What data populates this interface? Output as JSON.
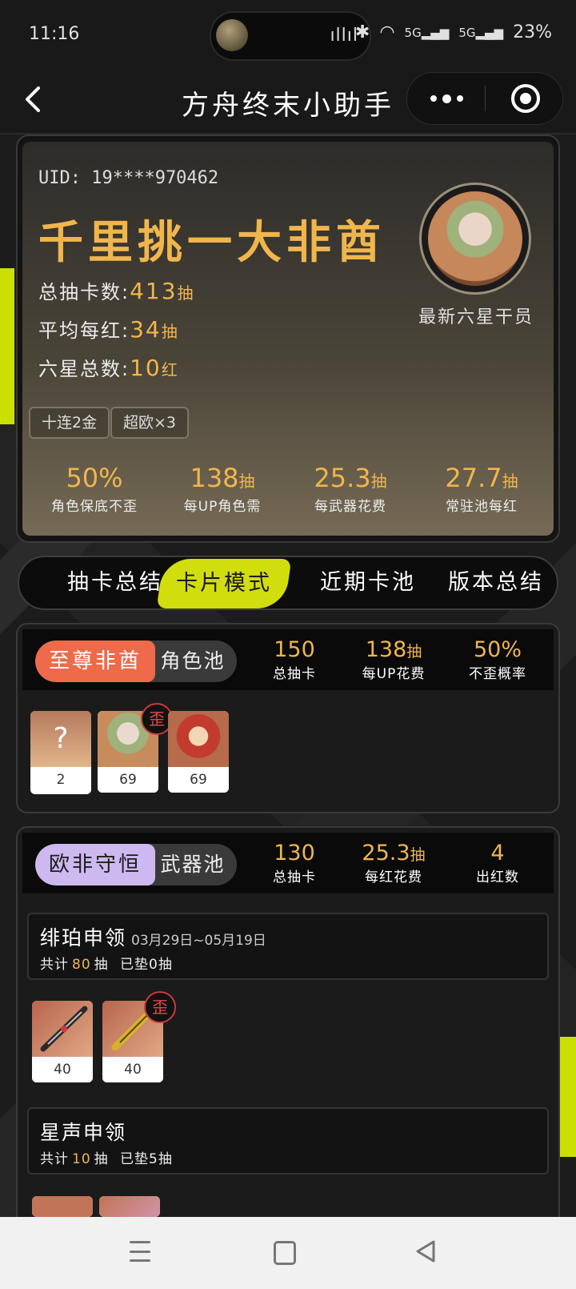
{
  "status_bar": {
    "time": "11:16",
    "battery": "23%",
    "signal1": "5G",
    "signal2": "5G"
  },
  "header": {
    "title": "方舟终末小助手"
  },
  "profile": {
    "uid": "UID: 19****970462",
    "nickname": "千里挑一大非酋",
    "stats": [
      {
        "label": "总抽卡数:",
        "value": "413",
        "unit": "抽"
      },
      {
        "label": "平均每红:",
        "value": "34",
        "unit": "抽"
      },
      {
        "label": "六星总数:",
        "value": "10",
        "unit": "红"
      }
    ],
    "avatar_caption": "最新六星干员",
    "tags": [
      "十连2金",
      "超欧×3"
    ],
    "summary": [
      {
        "value": "50%",
        "unit": "",
        "label": "角色保底不歪"
      },
      {
        "value": "138",
        "unit": "抽",
        "label": "每UP角色需"
      },
      {
        "value": "25.3",
        "unit": "抽",
        "label": "每武器花费"
      },
      {
        "value": "27.7",
        "unit": "抽",
        "label": "常驻池每红"
      }
    ]
  },
  "tabs": [
    "抽卡总结",
    "卡片模式",
    "近期卡池",
    "版本总结"
  ],
  "active_tab": "卡片模式",
  "character_pool": {
    "rank": "至尊非酋",
    "name": "角色池",
    "stats": [
      {
        "value": "150",
        "unit": "",
        "label": "总抽卡"
      },
      {
        "value": "138",
        "unit": "抽",
        "label": "每UP花费"
      },
      {
        "value": "50%",
        "unit": "",
        "label": "不歪概率"
      }
    ],
    "cards": [
      {
        "symbol": "?",
        "count": "2"
      },
      {
        "count": "69",
        "badge": "歪"
      },
      {
        "count": "69"
      }
    ]
  },
  "weapon_pool": {
    "rank": "欧非守恒",
    "name": "武器池",
    "stats": [
      {
        "value": "130",
        "unit": "",
        "label": "总抽卡"
      },
      {
        "value": "25.3",
        "unit": "抽",
        "label": "每红花费"
      },
      {
        "value": "4",
        "unit": "",
        "label": "出红数"
      }
    ],
    "banners": [
      {
        "name": "绯珀申领",
        "date": "03月29日~05月19日",
        "prefix": "共计",
        "total": "80",
        "suffix": "抽",
        "pity": "已垫0抽",
        "cards": [
          {
            "count": "40"
          },
          {
            "count": "40",
            "badge": "歪"
          }
        ]
      },
      {
        "name": "星声申领",
        "date": "",
        "prefix": "共计",
        "total": "10",
        "suffix": "抽",
        "pity": "已垫5抽"
      }
    ]
  },
  "colors": {
    "accent": "#f0b64c",
    "lime": "#d2dd0e",
    "rank_red": "#ef6a4a",
    "rank_purple": "#cdb8f0"
  }
}
